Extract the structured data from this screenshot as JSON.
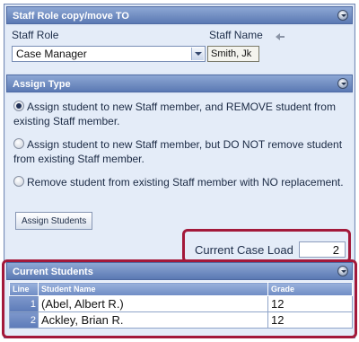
{
  "copy_move": {
    "title": "Staff Role copy/move TO",
    "staff_role_label": "Staff Role",
    "staff_role_value": "Case Manager",
    "staff_name_label": "Staff Name",
    "staff_name_value": "Smith, Jk"
  },
  "assign_type": {
    "title": "Assign Type",
    "options": [
      {
        "label": "Assign student to new Staff member, and REMOVE student from existing Staff member.",
        "selected": true
      },
      {
        "label": "Assign student to new Staff member, but DO NOT remove student from existing Staff member.",
        "selected": false
      },
      {
        "label": "Remove student from existing Staff member with NO replacement.",
        "selected": false
      }
    ],
    "button_label": "Assign Students"
  },
  "case_load": {
    "label": "Current Case Load",
    "value": "2"
  },
  "current_students": {
    "title": "Current Students",
    "columns": [
      "Line",
      "Student Name",
      "Grade"
    ],
    "rows": [
      {
        "line": "1",
        "name": "(Abel, Albert R.)",
        "grade": "12"
      },
      {
        "line": "2",
        "name": "Ackley, Brian R.",
        "grade": "12"
      }
    ]
  },
  "colors": {
    "header_blue": "#5b79b3",
    "panel_bg": "#e4ecf8",
    "highlight_red": "#a3193a"
  }
}
